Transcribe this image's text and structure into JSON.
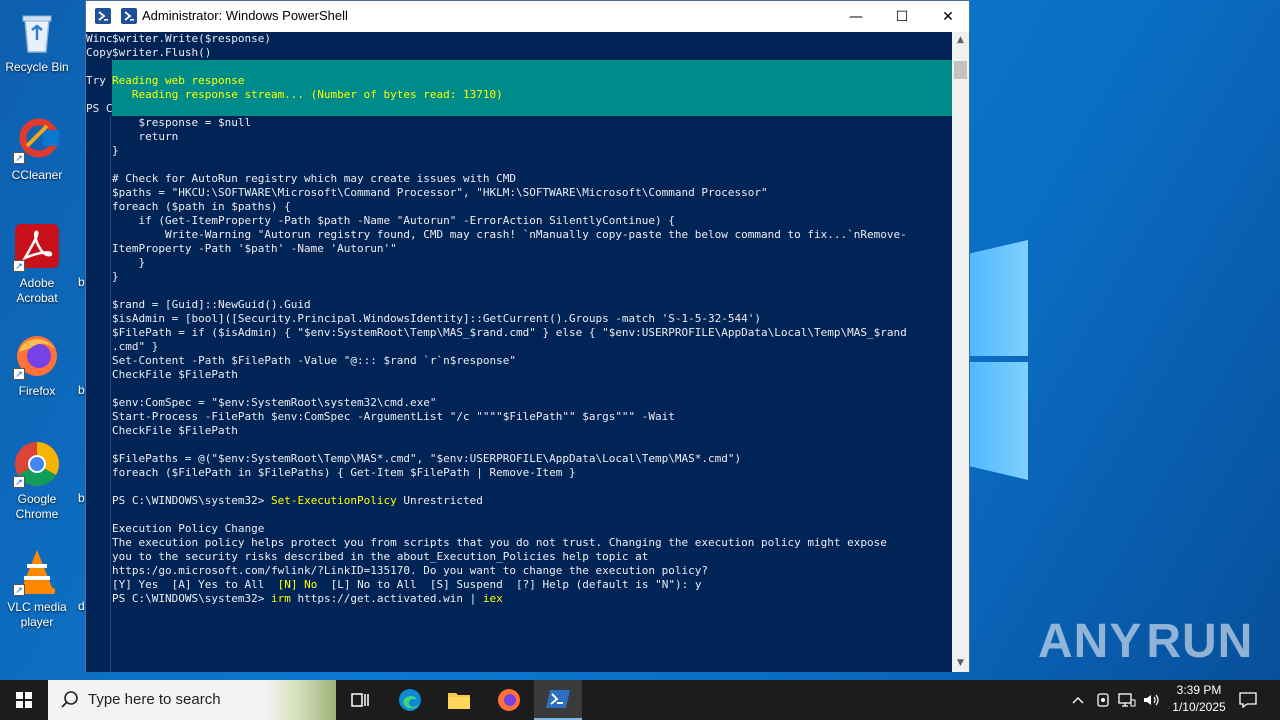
{
  "window": {
    "title": "Administrator: Windows PowerShell",
    "minimize_glyph": "—",
    "maximize_glyph": "☐",
    "close_glyph": "✕"
  },
  "console": {
    "peek_lines": "Winc\nCopy\n\nTry\n\nPS C",
    "top_lines": "$writer.Write($response)\n$writer.Flush()",
    "progress_title": "Reading web response",
    "progress_status": "   Reading response stream... (Number of bytes read: 13710)",
    "body_before": "    $response = $null\n    return\n}\n\n# Check for AutoRun registry which may create issues with CMD\n$paths = \"HKCU:\\SOFTWARE\\Microsoft\\Command Processor\", \"HKLM:\\SOFTWARE\\Microsoft\\Command Processor\"\nforeach ($path in $paths) {\n    if (Get-ItemProperty -Path $path -Name \"Autorun\" -ErrorAction SilentlyContinue) {\n        Write-Warning \"Autorun registry found, CMD may crash! `nManually copy-paste the below command to fix...`nRemove-\nItemProperty -Path '$path' -Name 'Autorun'\"\n    }\n}\n\n$rand = [Guid]::NewGuid().Guid\n$isAdmin = [bool]([Security.Principal.WindowsIdentity]::GetCurrent().Groups -match 'S-1-5-32-544')\n$FilePath = if ($isAdmin) { \"$env:SystemRoot\\Temp\\MAS_$rand.cmd\" } else { \"$env:USERPROFILE\\AppData\\Local\\Temp\\MAS_$rand\n.cmd\" }\nSet-Content -Path $FilePath -Value \"@::: $rand `r`n$response\"\nCheckFile $FilePath\n\n$env:ComSpec = \"$env:SystemRoot\\system32\\cmd.exe\"\nStart-Process -FilePath $env:ComSpec -ArgumentList \"/c \"\"\"\"$FilePath\"\" $args\"\"\" -Wait\nCheckFile $FilePath\n\n$FilePaths = @(\"$env:SystemRoot\\Temp\\MAS*.cmd\", \"$env:USERPROFILE\\AppData\\Local\\Temp\\MAS*.cmd\")\nforeach ($FilePath in $FilePaths) { Get-Item $FilePath | Remove-Item }\n",
    "prompt1": "PS C:\\WINDOWS\\system32> ",
    "cmd1": "Set-ExecutionPolicy",
    "cmd1_arg": " Unrestricted",
    "policy_text": "\nExecution Policy Change\nThe execution policy helps protect you from scripts that you do not trust. Changing the execution policy might expose\nyou to the security risks described in the about_Execution_Policies help topic at\nhttps:/go.microsoft.com/fwlink/?LinkID=135170. Do you want to change the execution policy?",
    "choice_pre": "[Y] Yes  [A] Yes to All  ",
    "choice_default": "[N] No",
    "choice_post": "  [L] No to All  [S] Suspend  [?] Help (default is \"N\"): y",
    "prompt2": "PS C:\\WINDOWS\\system32> ",
    "cmd2": "irm",
    "cmd2_arg": " https://get.activated.win | ",
    "cmd2_pipe": "iex"
  },
  "desktop": {
    "icons": [
      {
        "label": "Recycle Bin",
        "icon": "recycle-bin-icon"
      },
      {
        "label": "CCleaner",
        "icon": "ccleaner-icon"
      },
      {
        "label": "Adobe Acrobat",
        "icon": "acrobat-icon"
      },
      {
        "label": "Firefox",
        "icon": "firefox-icon"
      },
      {
        "label": "Google Chrome",
        "icon": "chrome-icon"
      },
      {
        "label": "VLC media player",
        "icon": "vlc-icon"
      }
    ],
    "truncated": [
      "b",
      "b",
      "b",
      "d"
    ],
    "watermark_left": "ANY",
    "watermark_right": "RUN"
  },
  "taskbar": {
    "search_placeholder": "Type here to search",
    "time": "3:39 PM",
    "date": "1/10/2025"
  },
  "colors": {
    "console_bg": "#012456",
    "progress_bg": "#008b8b",
    "highlight": "#ffff00"
  }
}
